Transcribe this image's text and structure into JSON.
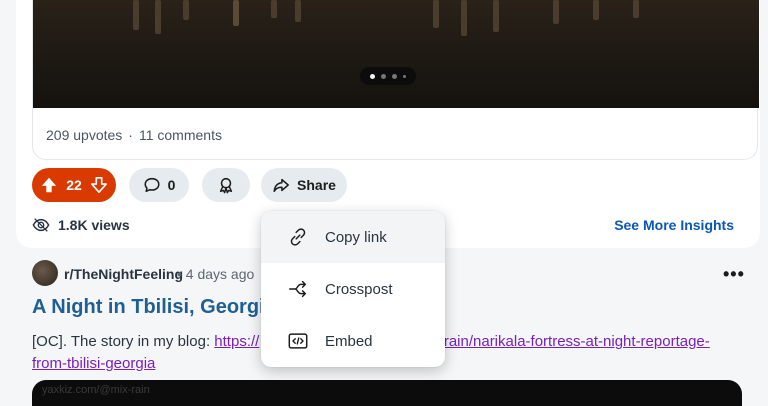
{
  "post": {
    "upvotes_text": "209 upvotes",
    "comments_text": "11 comments",
    "separator": "·",
    "carousel": {
      "slide_count": 4,
      "active_index": 0
    }
  },
  "actions": {
    "vote_count": "22",
    "comment_count": "0",
    "share_label": "Share",
    "views": "1.8K views",
    "see_more_insights": "See More Insights"
  },
  "share_menu": {
    "items": [
      {
        "label": "Copy link",
        "icon": "link-icon"
      },
      {
        "label": "Crosspost",
        "icon": "crosspost-icon"
      },
      {
        "label": "Embed",
        "icon": "embed-icon"
      }
    ]
  },
  "next_post": {
    "subreddit": "r/TheNightFeeling",
    "age": "• 4 days ago",
    "more": "•••",
    "title": "A Night in Tbilisi, Georgia",
    "body_prefix": "[OC]. The story in my blog: ",
    "link_visible_start": "https://",
    "link_visible_mid": "x-rain/narikala-fortress-at-night-reportage-",
    "link_visible_end": "from-tbilisi-georgia",
    "preview_watermark": "yaxkiz.com/@mix-rain"
  },
  "colors": {
    "upvote_active": "#d93a00",
    "link": "#0a58b4",
    "visited_link": "#7a1fb8",
    "title": "#1f5f96"
  }
}
